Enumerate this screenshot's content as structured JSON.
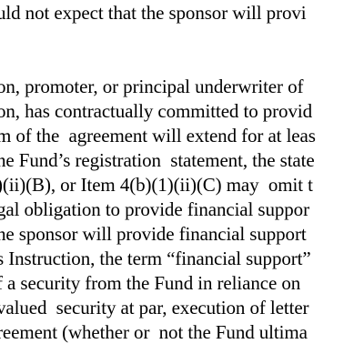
{
  "document": {
    "lines": [
      "uld not expect that the sponsor will provi",
      "on, promoter, or principal underwriter of",
      "on, has contractually committed to provid",
      "m of the  agreement will extend for at leas",
      "he Fund’s registration  statement, the state",
      ")(ii)(B), or Item 4(b)(1)(ii)(C) may  omit t",
      "gal obligation to provide financial suppor",
      "he sponsor will provide financial support",
      "s Instruction, the term “financial support”",
      "f a security from the Fund in reliance on",
      "valued  security at par, execution of letter",
      "reement (whether or  not the Fund ultima"
    ]
  }
}
